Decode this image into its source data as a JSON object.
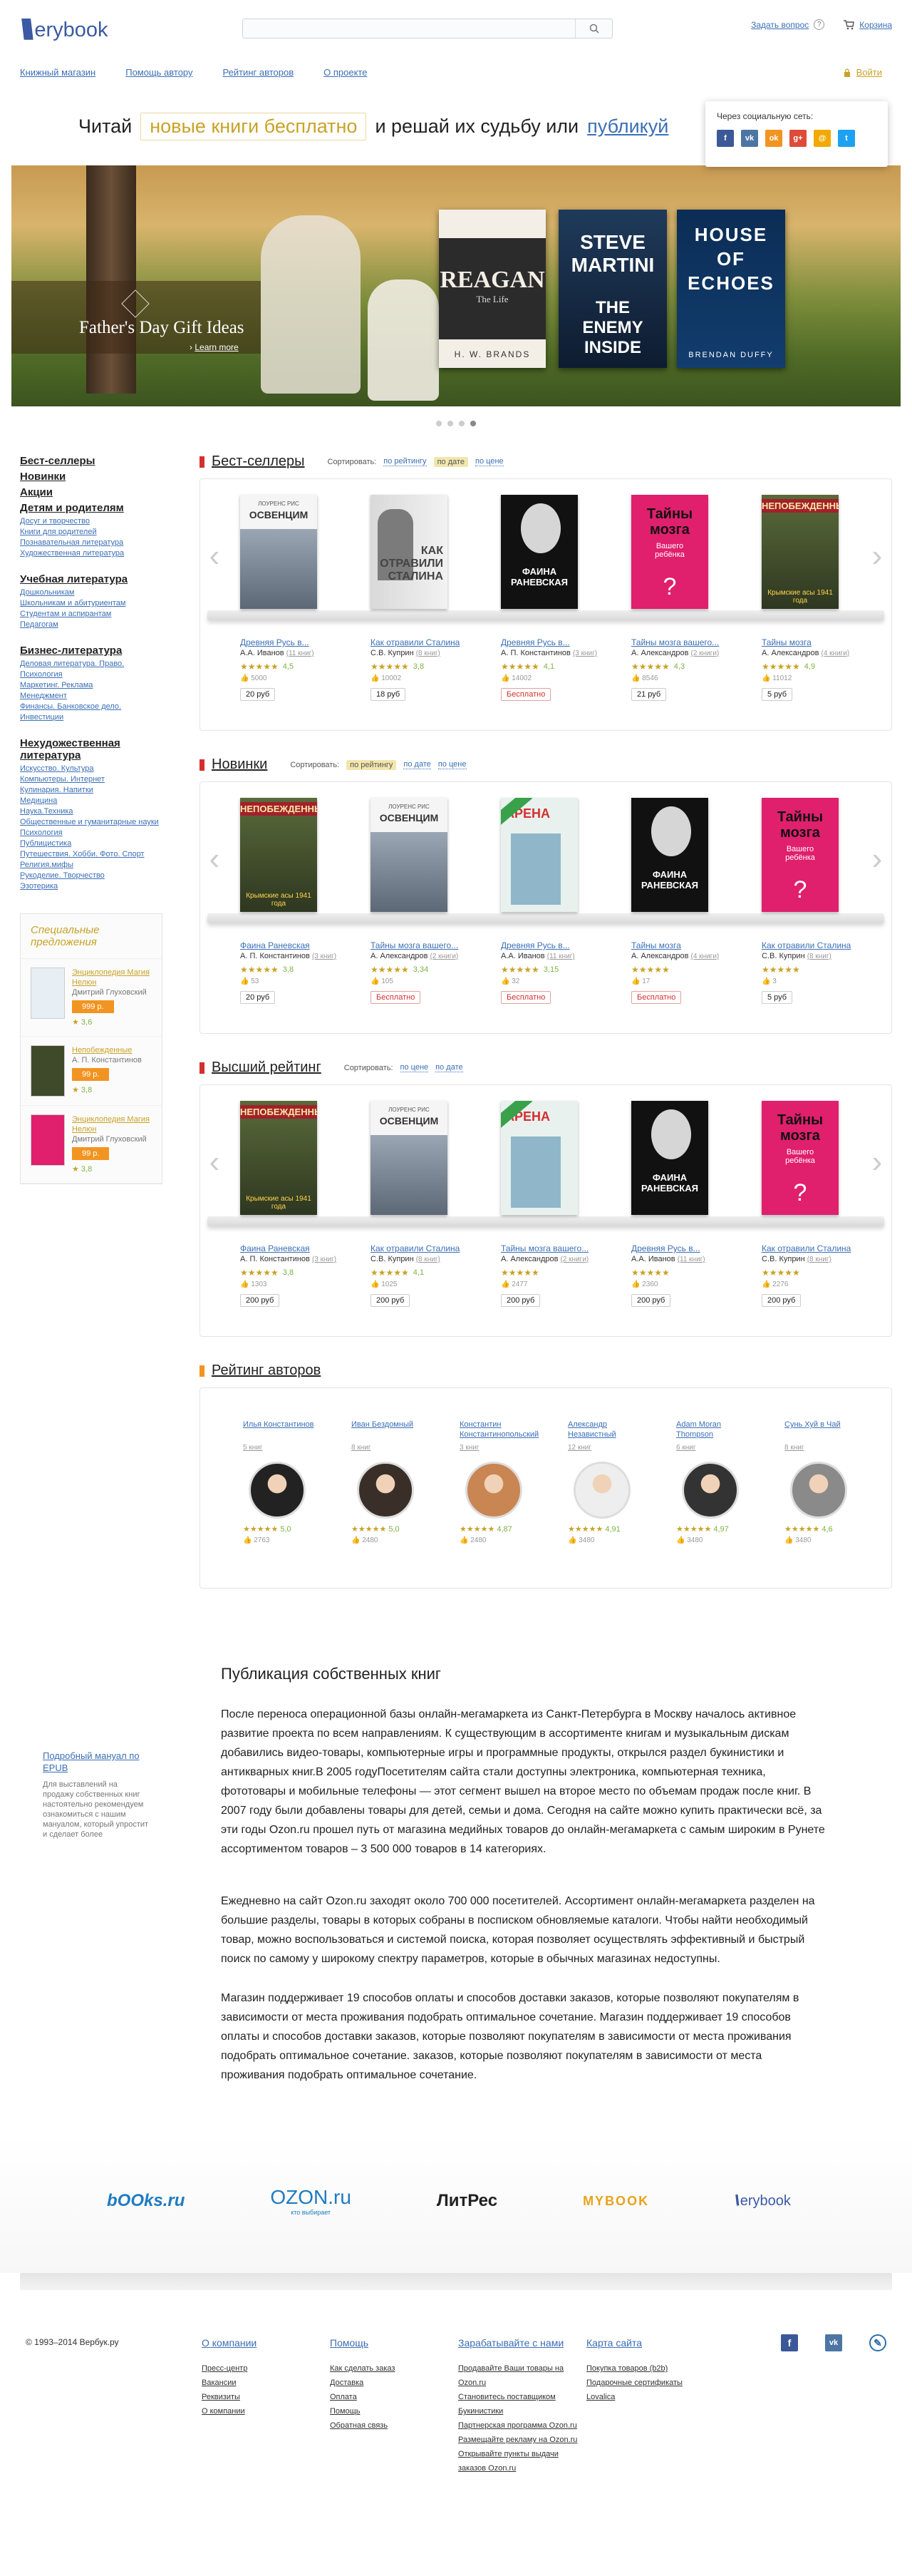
{
  "header": {
    "logo_text": "erybook",
    "search_placeholder": "",
    "ask_label": "Задать вопрос",
    "cart_label": "Корзина",
    "nav": [
      "Книжный магазин",
      "Помощь автору",
      "Рейтинг авторов",
      "О проекте"
    ],
    "login_label": "Войти"
  },
  "tagline": {
    "prefix": "Читай",
    "highlight": "новые книги бесплатно",
    "middle": "и решай их судьбу или",
    "link": "публикуй"
  },
  "social_popup": {
    "title": "Через социальную сеть:",
    "icons": [
      "facebook-icon",
      "vk-icon",
      "odnoklassniki-icon",
      "google-plus-icon",
      "mail-ru-icon",
      "twitter-icon"
    ]
  },
  "banner": {
    "title": "Father's Day Gift Ideas",
    "more": "Learn more",
    "covers": [
      {
        "big": "REAGAN",
        "small": "The Life",
        "author": "H. W. BRANDS"
      },
      {
        "big": "STEVE MARTINI",
        "small": "THE ENEMY INSIDE",
        "author": ""
      },
      {
        "big": "HOUSE OF ECHOES",
        "small": "",
        "author": "BRENDAN DUFFY"
      }
    ]
  },
  "sidebar": {
    "top_heads": [
      "Бест-селлеры",
      "Новинки",
      "Акции",
      "Детям и родителям"
    ],
    "kids_sub": [
      "Досуг и творчество",
      "Книги для родителей",
      "Познавательная литература",
      "Художественная литература"
    ],
    "edu_head": "Учебная литература",
    "edu_sub": [
      "Дошкольникам",
      "Школьникам и абитуриентам",
      "Студентам и аспирантам",
      "Педагогам"
    ],
    "biz_head": "Бизнес-литература",
    "biz_sub": [
      "Деловая литература. Право. Психология",
      "Маркетинг. Реклама",
      "Менеджмент",
      "Финансы. Банковское дело. Инвестиции"
    ],
    "nonfic_head": "Нехудожественная литература",
    "nonfic_sub": [
      "Искусство. Культура",
      "Компьютеры. Интернет",
      "Кулинария. Напитки",
      "Медицина",
      "Наука.Техника",
      "Общественные и гуманитарные науки",
      "Психология",
      "Публицистика",
      "Путешествия. Хобби. Фото. Спорт",
      "Религия.мифы",
      "Рукоделие. Творчество",
      "Эзотерика"
    ]
  },
  "offers": {
    "title": "Специальные предложения",
    "items": [
      {
        "title": "Энциклопедия Магия Нелюн",
        "author": "Дмитрий Глуховский",
        "price": "999 р.",
        "score": "3,6",
        "color": "#e7eef4"
      },
      {
        "title": "Непобежденные",
        "author": "А. П. Константинов",
        "price": "99 р.",
        "score": "3,8",
        "color": "#3e4a2a"
      },
      {
        "title": "Энциклопедия Магия Нелюн",
        "author": "Дмитрий Глуховский",
        "price": "99 р.",
        "score": "3,8",
        "color": "#e01f6d"
      }
    ]
  },
  "bestsellers": {
    "title": "Бест-селлеры",
    "sort_label": "Сортировать:",
    "sort_opts": [
      "по рейтингу",
      "по дате",
      "по цене"
    ],
    "sort_active": 1,
    "books": [
      {
        "title": "Древняя Русь в...",
        "author": "А.А. Иванов",
        "count": "(11 книг)",
        "score": "4,5",
        "likes": "5000",
        "price": "20 руб",
        "free": false,
        "cover": "osvencim"
      },
      {
        "title": "Как отравили Сталина",
        "author": "С.В. Куприн",
        "count": "(8 книг)",
        "score": "3,8",
        "likes": "10002",
        "price": "18 руб",
        "free": false,
        "cover": "stalin"
      },
      {
        "title": "Древняя Русь в...",
        "author": "А. П. Константинов",
        "count": "(3 книг)",
        "score": "4,1",
        "likes": "14002",
        "price": "Бесплатно",
        "free": true,
        "cover": "ranevskaya"
      },
      {
        "title": "Тайны мозга вашего...",
        "author": "А. Александров",
        "count": "(2 книги)",
        "score": "4,3",
        "likes": "8546",
        "price": "21 руб",
        "free": false,
        "cover": "brain"
      },
      {
        "title": "Тайны мозга",
        "author": "А. Александров",
        "count": "(4 книги)",
        "score": "4,9",
        "likes": "11012",
        "price": "5 руб",
        "free": false,
        "cover": "soldier"
      }
    ]
  },
  "novelties": {
    "title": "Новинки",
    "sort_label": "Сортировать:",
    "sort_opts": [
      "по рейтингу",
      "по дате",
      "по цене"
    ],
    "sort_active": 0,
    "books": [
      {
        "title": "Фаина Раневская",
        "author": "А. П. Константинов",
        "count": "(3 книг)",
        "score": "3,8",
        "likes": "53",
        "price": "20 руб",
        "free": false,
        "cover": "soldier"
      },
      {
        "title": "Тайны мозга вашего...",
        "author": "А. Александров",
        "count": "(2 книги)",
        "score": "3,34",
        "likes": "105",
        "price": "Бесплатно",
        "free": true,
        "cover": "osvencim"
      },
      {
        "title": "Древняя Русь в...",
        "author": "А.А. Иванов",
        "count": "(11 книг)",
        "score": "3,15",
        "likes": "32",
        "price": "Бесплатно",
        "free": true,
        "cover": "arena"
      },
      {
        "title": "Тайны мозга",
        "author": "А. Александров",
        "count": "(4 книги)",
        "score": "",
        "likes": "17",
        "price": "Бесплатно",
        "free": true,
        "cover": "ranevskaya"
      },
      {
        "title": "Как отравили Сталина",
        "author": "С.В. Куприн",
        "count": "(8 книг)",
        "score": "",
        "likes": "3",
        "price": "5 руб",
        "free": false,
        "cover": "brain"
      }
    ]
  },
  "toprated": {
    "title": "Высший рейтинг",
    "sort_label": "Сортировать:",
    "sort_opts": [
      "по цене",
      "по дате"
    ],
    "sort_active": -1,
    "books": [
      {
        "title": "Фаина Раневская",
        "author": "А. П. Константинов",
        "count": "(3 книг)",
        "score": "3,8",
        "likes": "1303",
        "price": "200 руб",
        "free": false,
        "cover": "soldier"
      },
      {
        "title": "Как отравили Сталина",
        "author": "С.В. Куприн",
        "count": "(8 книг)",
        "score": "4,1",
        "likes": "1025",
        "price": "200 руб",
        "free": false,
        "cover": "osvencim"
      },
      {
        "title": "Тайны мозга вашего...",
        "author": "А. Александров",
        "count": "(2 книги)",
        "score": "",
        "likes": "2477",
        "price": "200 руб",
        "free": false,
        "cover": "arena"
      },
      {
        "title": "Древняя Русь в...",
        "author": "А.А. Иванов",
        "count": "(11 книг)",
        "score": "",
        "likes": "2360",
        "price": "200 руб",
        "free": false,
        "cover": "ranevskaya"
      },
      {
        "title": "Как отравили Сталина",
        "author": "С.В. Куприн",
        "count": "(8 книг)",
        "score": "",
        "likes": "2276",
        "price": "200 руб",
        "free": false,
        "cover": "brain"
      }
    ]
  },
  "authors": {
    "title": "Рейтинг авторов",
    "list": [
      {
        "name": "Илья Константинов",
        "books": "5 книг",
        "score": "5,0",
        "likes": "2763",
        "bg": "#222"
      },
      {
        "name": "Иван Бездомный",
        "books": "8 книг",
        "score": "5,0",
        "likes": "2480",
        "bg": "#3a2e28"
      },
      {
        "name": "Константин Константинопольский",
        "books": "3 книг",
        "score": "4,87",
        "likes": "2480",
        "bg": "#c98552"
      },
      {
        "name": "Александр Независтный",
        "books": "12 книг",
        "score": "4,91",
        "likes": "3480",
        "bg": "#eee"
      },
      {
        "name": "Adam Moran Thompson",
        "books": "6 книг",
        "score": "4,97",
        "likes": "3480",
        "bg": "#333"
      },
      {
        "name": "Сунь Хуй в Чай",
        "books": "8 книг",
        "score": "4,6",
        "likes": "3480",
        "bg": "#8a8a8a"
      }
    ]
  },
  "epub": {
    "link": "Подробный мануал по EPUB",
    "text": "Для выставлений на продажу собственных книг настоятельно рекомендуем ознакомиться с нашим мануалом, который упростит и сделает более"
  },
  "article": {
    "title": "Публикация собственных книг",
    "p1": "После переноса операционной базы онлайн-мегамаркета из Санкт-Петербурга в Москву началось активное развитие проекта по всем направлениям. К существующим в ассортименте книгам и музыкальным дискам добавились видео-товары, компьютерные игры и программные продукты, открылся раздел букинистики и антикварных книг.В 2005 годуПосетителям сайта стали доступны электроника, компьютерная техника, фототовары и мобильные телефоны — этот сегмент вышел на второе место по объемам продаж после книг. В 2007 году были добавлены товары для детей, семьи и дома. Сегодня на сайте можно купить практически всё, за эти годы Ozon.ru прошел путь от магазина медийных товаров до онлайн-мегамаркета с самым широким в Рунете ассортиментом товаров – 3 500 000 товаров в 14 категориях.",
    "p2": "Ежедневно на сайт Ozon.ru заходят около 700 000 посетителей. Ассортимент онлайн-мегамаркета разделен на большие разделы, товары в которых собраны в посписком обновляемые каталоги. Чтобы найти необходимый товар, можно воспользоваться и системой поиска, которая позволяет осуществлять эффективный и быстрый поиск по самому у широкому спектру параметров, которые в обычных магазинах недоступны.",
    "p3": "Магазин поддерживает 19 способов оплаты и способов доставки заказов, которые позволяют покупателям в зависимости от места проживания подобрать оптимальное сочетание. Магазин поддерживает 19 способов оплаты и способов доставки заказов, которые позволяют покупателям в зависимости от места проживания подобрать оптимальное сочетание. заказов, которые позволяют покупателям в зависимости от места проживания подобрать оптимальное сочетание."
  },
  "partners": [
    "bOOks.ru",
    "OZON.ru",
    "ЛитРес",
    "MYBOOK",
    "erybook"
  ],
  "partners_sub": "кто выбирает",
  "footer": {
    "copy": "© 1993–2014 Вербук.ру",
    "cols": [
      {
        "head": "О компании",
        "links": [
          "Пресс-центр",
          "Вакансии",
          "Реквизиты",
          "О компании"
        ]
      },
      {
        "head": "Помощь",
        "links": [
          "Как сделать заказ",
          "Доставка",
          "Оплата",
          "Помощь",
          "Обратная связь"
        ]
      },
      {
        "head": "Зарабатывайте с нами",
        "links": [
          "Продавайте Ваши товары на Ozon.ru",
          "Становитесь поставщиком Букинистики",
          "Партнерская программа Ozon.ru",
          "Размещайте рекламу на Ozon.ru",
          "Открывайте пункты выдачи заказов Ozon.ru"
        ]
      },
      {
        "head": "Карта сайта",
        "links": [
          "Покупка товаров (b2b)",
          "Подарочные сертификаты",
          "Lovalica"
        ]
      }
    ]
  }
}
